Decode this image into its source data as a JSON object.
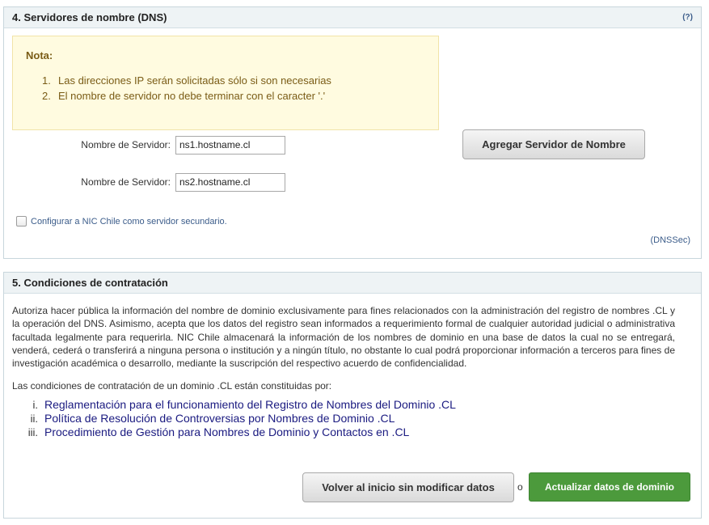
{
  "dns_section": {
    "title": "4. Servidores de nombre (DNS)",
    "help": "(?)",
    "note": {
      "title": "Nota:",
      "items": [
        {
          "num": "1.",
          "text": "Las direcciones IP serán solicitadas sólo si son necesarias"
        },
        {
          "num": "2.",
          "text": "El nombre de servidor no debe terminar con el caracter '.'"
        }
      ]
    },
    "nameservers": [
      {
        "label": "Nombre de Servidor:",
        "value": "ns1.hostname.cl"
      },
      {
        "label": "Nombre de Servidor:",
        "value": "ns2.hostname.cl"
      }
    ],
    "add_button": "Agregar Servidor de Nombre",
    "secondary_checkbox": {
      "label": "Configurar a NIC Chile como servidor secundario.",
      "checked": false
    },
    "dnssec_link": "(DNSSec)"
  },
  "contract_section": {
    "title": "5. Condiciones de contratación",
    "paragraph": "Autoriza hacer pública la información del nombre de dominio exclusivamente para fines relacionados con la administración del registro de nombres .CL y la operación del DNS. Asimismo, acepta que los datos del registro sean informados a requerimiento formal de cualquier autoridad judicial o administrativa facultada legalmente para requerirla. NIC Chile almacenará la información de los nombres de dominio en una base de datos la cual no se entregará, venderá, cederá o transferirá a ninguna persona o institución y a ningún título, no obstante lo cual podrá proporcionar información a terceros para fines de investigación académica o desarrollo, mediante la suscripción del respectivo acuerdo de confidencialidad.",
    "intro": "Las condiciones de contratación de un dominio .CL están constituidas por:",
    "documents": [
      {
        "num": "i.",
        "text": "Reglamentación para el funcionamiento del Registro de Nombres del Dominio .CL"
      },
      {
        "num": "ii.",
        "text": "Política de Resolución de Controversias por Nombres de Dominio .CL"
      },
      {
        "num": "iii.",
        "text": "Procedimiento de Gestión para Nombres de Dominio y Contactos en .CL"
      }
    ],
    "back_button": "Volver al inicio sin modificar datos",
    "or_text": "o",
    "update_button": "Actualizar datos de dominio"
  }
}
